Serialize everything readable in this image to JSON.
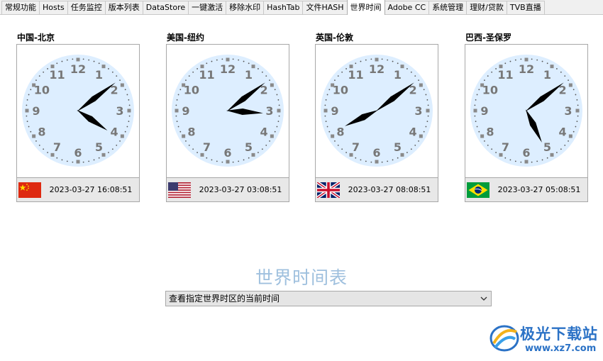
{
  "tabs": [
    {
      "label": "常规功能",
      "active": false
    },
    {
      "label": "Hosts",
      "active": false
    },
    {
      "label": "任务监控",
      "active": false
    },
    {
      "label": "版本列表",
      "active": false
    },
    {
      "label": "DataStore",
      "active": false
    },
    {
      "label": "一键激活",
      "active": false
    },
    {
      "label": "移除水印",
      "active": false
    },
    {
      "label": "HashTab",
      "active": false
    },
    {
      "label": "文件HASH",
      "active": false
    },
    {
      "label": "世界时间",
      "active": true
    },
    {
      "label": "Adobe CC",
      "active": false
    },
    {
      "label": "系统管理",
      "active": false
    },
    {
      "label": "理财/贷款",
      "active": false
    },
    {
      "label": "TVB直播",
      "active": false
    }
  ],
  "clocks": [
    {
      "city": "中国-北京",
      "datetime": "2023-03-27 16:08:51",
      "flag_icon": "china-flag-icon",
      "hour": 16,
      "minute": 8,
      "second": 51
    },
    {
      "city": "美国-纽约",
      "datetime": "2023-03-27 03:08:51",
      "flag_icon": "usa-flag-icon",
      "hour": 3,
      "minute": 8,
      "second": 51
    },
    {
      "city": "英国-伦敦",
      "datetime": "2023-03-27 08:08:51",
      "flag_icon": "uk-flag-icon",
      "hour": 8,
      "minute": 8,
      "second": 51
    },
    {
      "city": "巴西-圣保罗",
      "datetime": "2023-03-27 05:08:51",
      "flag_icon": "brazil-flag-icon",
      "hour": 5,
      "minute": 8,
      "second": 51
    }
  ],
  "clock_numerals": [
    "12",
    "1",
    "2",
    "3",
    "4",
    "5",
    "6",
    "7",
    "8",
    "9",
    "10",
    "11"
  ],
  "section_title": "世界时间表",
  "timezone_select": {
    "value": "查看指定世界时区的当前时间",
    "icon": "chevron-down-icon"
  },
  "watermark": {
    "name": "极光下载站",
    "url": "www.xz7.com",
    "icon": "aurora-logo-icon"
  },
  "colors": {
    "clock_face": "#ddeeff",
    "numeral": "#777777",
    "hand": "#000000",
    "title": "#9fc0de",
    "watermark": "#2b72c6"
  }
}
